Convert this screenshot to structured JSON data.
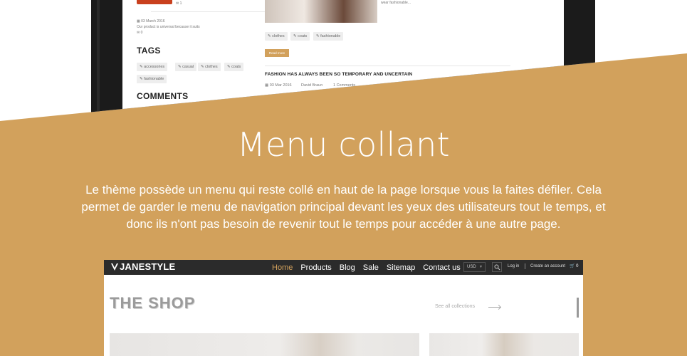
{
  "top_preview": {
    "side_small_count": "1",
    "sidebar_date": "03 March 2016",
    "sidebar_desc": "Our product is universal because it suits",
    "sidebar_count": "0",
    "tags_heading": "TAGS",
    "tags": [
      "accessories",
      "casual",
      "clothes",
      "coats",
      "fashionable"
    ],
    "comments_heading": "COMMENTS",
    "post_excerpt": "wear fashionable...",
    "post_tags": [
      "clothes",
      "coats",
      "fashionable"
    ],
    "read_more": "Read more",
    "post_title": "FASHION HAS ALWAYS BEEN SO TEMPORARY AND UNCERTAIN",
    "post_date": "03 Mar 2016",
    "post_author": "David Braun",
    "post_comments": "1 Comments"
  },
  "feature": {
    "heading": "Menu collant",
    "description": "Le thème possède un menu qui reste collé en haut de la page lorsque vous la faites défiler. Cela permet de garder le menu de navigation principal devant les yeux des utilisateurs tout le temps, et donc ils n'ont pas besoin de revenir tout le temps pour accéder à une autre page."
  },
  "shop_preview": {
    "logo": "JANESTYLE",
    "nav": [
      "Home",
      "Products",
      "Blog",
      "Sale",
      "Sitemap",
      "Contact us"
    ],
    "active_nav": "Home",
    "currency": "USD",
    "login": "Log in",
    "create_account": "Create an account",
    "cart_count": "0",
    "shop_title": "THE SHOP",
    "see_all": "See all collections"
  },
  "colors": {
    "accent": "#d2a15c",
    "navbar": "#2b2b2b",
    "device": "#1b1b1b"
  }
}
